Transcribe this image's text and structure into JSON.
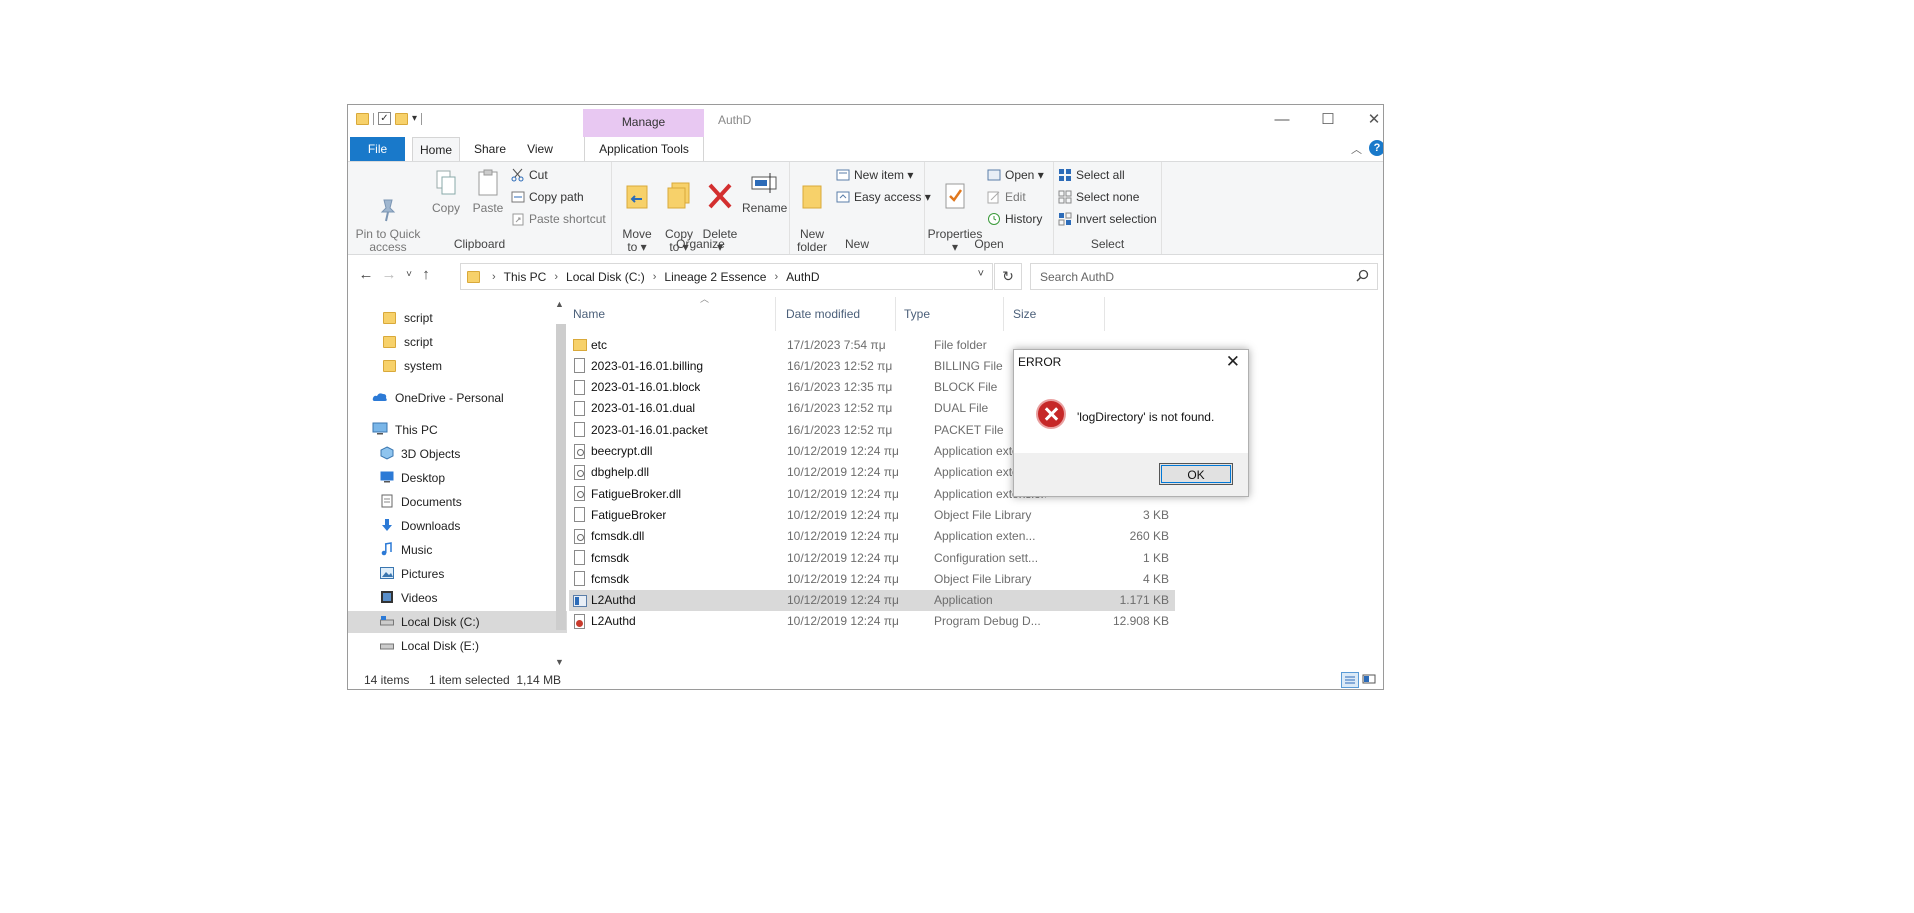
{
  "window": {
    "title": "AuthD",
    "manage_tab": "Manage",
    "controls": [
      "—",
      "☐",
      "✕"
    ]
  },
  "ribbon_tabs": [
    "File",
    "Home",
    "Share",
    "View",
    "Application Tools"
  ],
  "ribbon": {
    "clipboard": {
      "label": "Clipboard",
      "pin": "Pin to Quick\naccess",
      "copy": "Copy",
      "paste": "Paste",
      "cut": "Cut",
      "copy_path": "Copy path",
      "paste_shortcut": "Paste shortcut"
    },
    "organize": {
      "label": "Organize",
      "move_to": "Move\nto ▾",
      "copy_to": "Copy\nto ▾",
      "delete": "Delete\n▾",
      "rename": "Rename"
    },
    "new": {
      "label": "New",
      "new_folder": "New\nfolder",
      "new_item": "New item ▾",
      "easy_access": "Easy access ▾"
    },
    "open": {
      "label": "Open",
      "properties": "Properties\n▾",
      "open": "Open ▾",
      "edit": "Edit",
      "history": "History"
    },
    "select": {
      "label": "Select",
      "select_all": "Select all",
      "select_none": "Select none",
      "invert": "Invert selection"
    }
  },
  "address": {
    "crumbs": [
      "This PC",
      "Local Disk (C:)",
      "Lineage 2 Essence",
      "AuthD"
    ]
  },
  "search": {
    "placeholder": "Search AuthD"
  },
  "sidebar": {
    "items": [
      {
        "label": "script",
        "icon": "folder-icon"
      },
      {
        "label": "script",
        "icon": "folder-icon"
      },
      {
        "label": "system",
        "icon": "folder-icon"
      },
      {
        "label": "OneDrive - Personal",
        "icon": "cloud-icon"
      },
      {
        "label": "This PC",
        "icon": "computer-icon"
      },
      {
        "label": "3D Objects",
        "icon": "cube-icon"
      },
      {
        "label": "Desktop",
        "icon": "desktop-icon"
      },
      {
        "label": "Documents",
        "icon": "documents-icon"
      },
      {
        "label": "Downloads",
        "icon": "download-icon"
      },
      {
        "label": "Music",
        "icon": "music-icon"
      },
      {
        "label": "Pictures",
        "icon": "pictures-icon"
      },
      {
        "label": "Videos",
        "icon": "videos-icon"
      },
      {
        "label": "Local Disk (C:)",
        "icon": "drive-icon"
      },
      {
        "label": "Local Disk (E:)",
        "icon": "drive-icon"
      }
    ]
  },
  "columns": {
    "name": "Name",
    "date": "Date modified",
    "type": "Type",
    "size": "Size"
  },
  "files": [
    {
      "name": "etc",
      "date": "17/1/2023 7:54 πμ",
      "type": "File folder",
      "size": "",
      "icon": "folder"
    },
    {
      "name": "2023-01-16.01.billing",
      "date": "16/1/2023 12:52 πμ",
      "type": "BILLING File",
      "size": "",
      "icon": "doc"
    },
    {
      "name": "2023-01-16.01.block",
      "date": "16/1/2023 12:35 πμ",
      "type": "BLOCK File",
      "size": "",
      "icon": "doc"
    },
    {
      "name": "2023-01-16.01.dual",
      "date": "16/1/2023 12:52 πμ",
      "type": "DUAL File",
      "size": "",
      "icon": "doc"
    },
    {
      "name": "2023-01-16.01.packet",
      "date": "16/1/2023 12:52 πμ",
      "type": "PACKET File",
      "size": "",
      "icon": "doc"
    },
    {
      "name": "beecrypt.dll",
      "date": "10/12/2019 12:24 πμ",
      "type": "Application extension",
      "size": "",
      "icon": "dll"
    },
    {
      "name": "dbghelp.dll",
      "date": "10/12/2019 12:24 πμ",
      "type": "Application extension",
      "size": "",
      "icon": "dll"
    },
    {
      "name": "FatigueBroker.dll",
      "date": "10/12/2019 12:24 πμ",
      "type": "Application extension",
      "size": "",
      "icon": "dll"
    },
    {
      "name": "FatigueBroker",
      "date": "10/12/2019 12:24 πμ",
      "type": "Object File Library",
      "size": "3 KB",
      "icon": "doc"
    },
    {
      "name": "fcmsdk.dll",
      "date": "10/12/2019 12:24 πμ",
      "type": "Application exten...",
      "size": "260 KB",
      "icon": "dll"
    },
    {
      "name": "fcmsdk",
      "date": "10/12/2019 12:24 πμ",
      "type": "Configuration sett...",
      "size": "1 KB",
      "icon": "doc"
    },
    {
      "name": "fcmsdk",
      "date": "10/12/2019 12:24 πμ",
      "type": "Object File Library",
      "size": "4 KB",
      "icon": "doc"
    },
    {
      "name": "L2Authd",
      "date": "10/12/2019 12:24 πμ",
      "type": "Application",
      "size": "1.171 KB",
      "icon": "app"
    },
    {
      "name": "L2Authd",
      "date": "10/12/2019 12:24 πμ",
      "type": "Program Debug D...",
      "size": "12.908 KB",
      "icon": "pdb"
    }
  ],
  "status": {
    "count": "14 items",
    "selection": "1 item selected  1,14 MB"
  },
  "dialog": {
    "title": "ERROR",
    "message": "'logDirectory' is not found.",
    "ok": "OK",
    "close": "✕"
  },
  "colors": {
    "accent": "#1979ca",
    "manage": "#e8c8f2",
    "error": "#c62828"
  }
}
